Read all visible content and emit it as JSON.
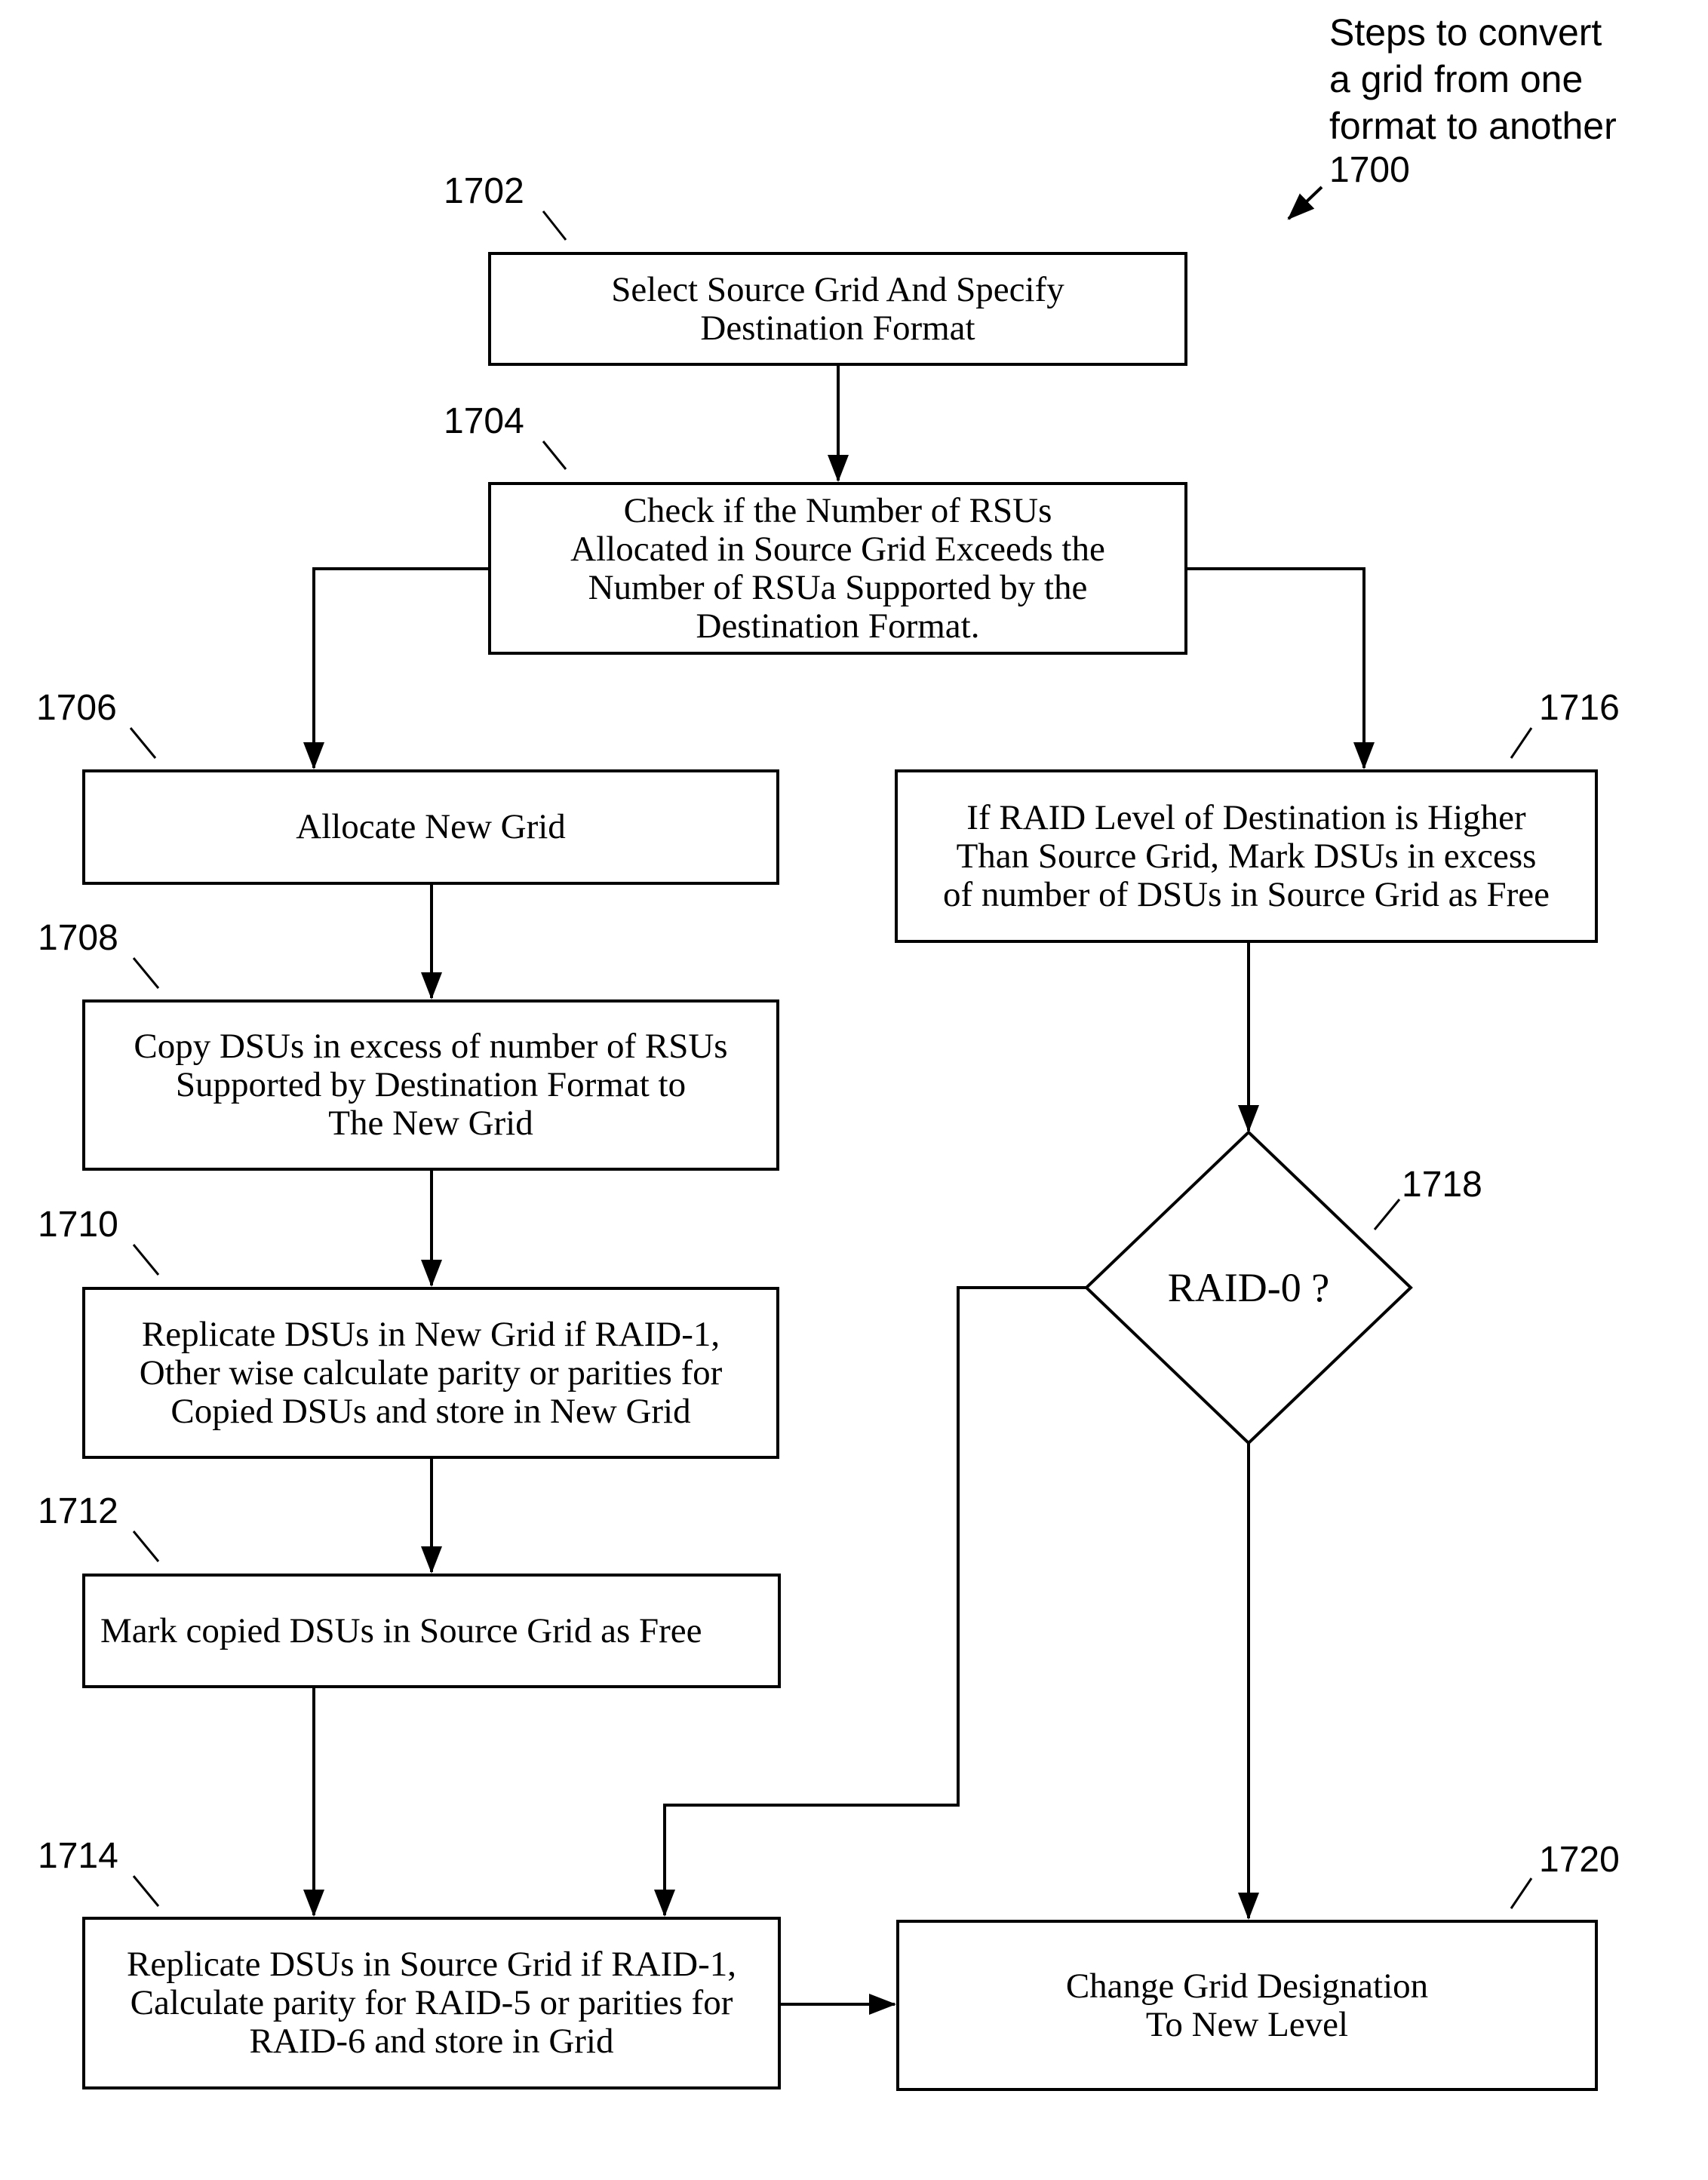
{
  "figure": {
    "title": "Steps to convert\na grid from one\nformat to another",
    "figure_ref": "1700"
  },
  "steps": {
    "s1702": {
      "ref": "1702",
      "text": "Select Source Grid And Specify\nDestination Format"
    },
    "s1704": {
      "ref": "1704",
      "text": "Check if the Number of RSUs\nAllocated in Source Grid Exceeds the\nNumber of RSUa Supported by the\nDestination Format."
    },
    "s1706": {
      "ref": "1706",
      "text": "Allocate New Grid"
    },
    "s1708": {
      "ref": "1708",
      "text": "Copy DSUs in excess of number of RSUs\nSupported by Destination Format to\nThe New Grid"
    },
    "s1710": {
      "ref": "1710",
      "text": "Replicate DSUs in New Grid if RAID-1,\nOther wise calculate parity or parities for\nCopied DSUs and store in New Grid"
    },
    "s1712": {
      "ref": "1712",
      "text": "Mark copied DSUs in Source Grid as Free"
    },
    "s1714": {
      "ref": "1714",
      "text": "Replicate DSUs in Source Grid if RAID-1,\nCalculate parity for RAID-5 or parities for\nRAID-6 and store in Grid"
    },
    "s1716": {
      "ref": "1716",
      "text": "If RAID Level of Destination is Higher\nThan Source Grid, Mark DSUs in excess\nof number of DSUs in Source Grid as Free"
    },
    "s1718": {
      "ref": "1718",
      "text": "RAID-0 ?"
    },
    "s1720": {
      "ref": "1720",
      "text": "Change Grid Designation\nTo New Level"
    }
  },
  "connections": [
    {
      "from": "1702",
      "to": "1704"
    },
    {
      "from": "1704",
      "to": "1706"
    },
    {
      "from": "1704",
      "to": "1716"
    },
    {
      "from": "1706",
      "to": "1708"
    },
    {
      "from": "1708",
      "to": "1710"
    },
    {
      "from": "1710",
      "to": "1712"
    },
    {
      "from": "1712",
      "to": "1714"
    },
    {
      "from": "1716",
      "to": "1718"
    },
    {
      "from": "1718",
      "to": "1714"
    },
    {
      "from": "1718",
      "to": "1720"
    },
    {
      "from": "1714",
      "to": "1720"
    }
  ]
}
